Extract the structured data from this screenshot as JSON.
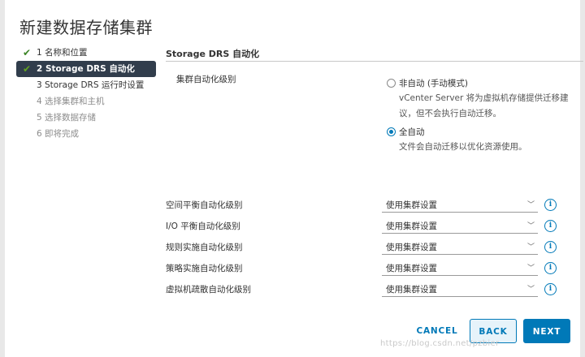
{
  "dialog": {
    "title": "新建数据存储集群"
  },
  "steps": [
    {
      "label": "1 名称和位置",
      "state": "done"
    },
    {
      "label": "2 Storage DRS 自动化",
      "state": "active"
    },
    {
      "label": "3 Storage DRS 运行时设置",
      "state": "enabled"
    },
    {
      "label": "4 选择集群和主机",
      "state": "disabled"
    },
    {
      "label": "5 选择数据存储",
      "state": "disabled"
    },
    {
      "label": "6 即将完成",
      "state": "disabled"
    }
  ],
  "content": {
    "section_title": "Storage DRS 自动化",
    "cluster_automation_label": "集群自动化级别",
    "options": [
      {
        "label": "非自动 (手动模式)",
        "desc_line1": "vCenter Server 将为虚拟机存储提供迁移建",
        "desc_line2": "议，但不会执行自动迁移。",
        "checked": false
      },
      {
        "label": "全自动",
        "desc_line1": "文件会自动迁移以优化资源使用。",
        "checked": true
      }
    ],
    "rows": [
      {
        "label": "空间平衡自动化级别",
        "value": "使用集群设置"
      },
      {
        "label": "I/O 平衡自动化级别",
        "value": "使用集群设置"
      },
      {
        "label": "规则实施自动化级别",
        "value": "使用集群设置"
      },
      {
        "label": "策略实施自动化级别",
        "value": "使用集群设置"
      },
      {
        "label": "虚拟机疏散自动化级别",
        "value": "使用集群设置"
      }
    ]
  },
  "footer": {
    "cancel": "CANCEL",
    "back": "BACK",
    "next": "NEXT"
  },
  "watermark": "https://blog.csdn.net/pzbier",
  "icons": {
    "check": "checkmark-icon",
    "info": "info-icon",
    "chevron": "chevron-down-icon"
  },
  "colors": {
    "accent": "#0079b8",
    "active_step_bg": "#313d4c",
    "check": "#3c8527"
  }
}
